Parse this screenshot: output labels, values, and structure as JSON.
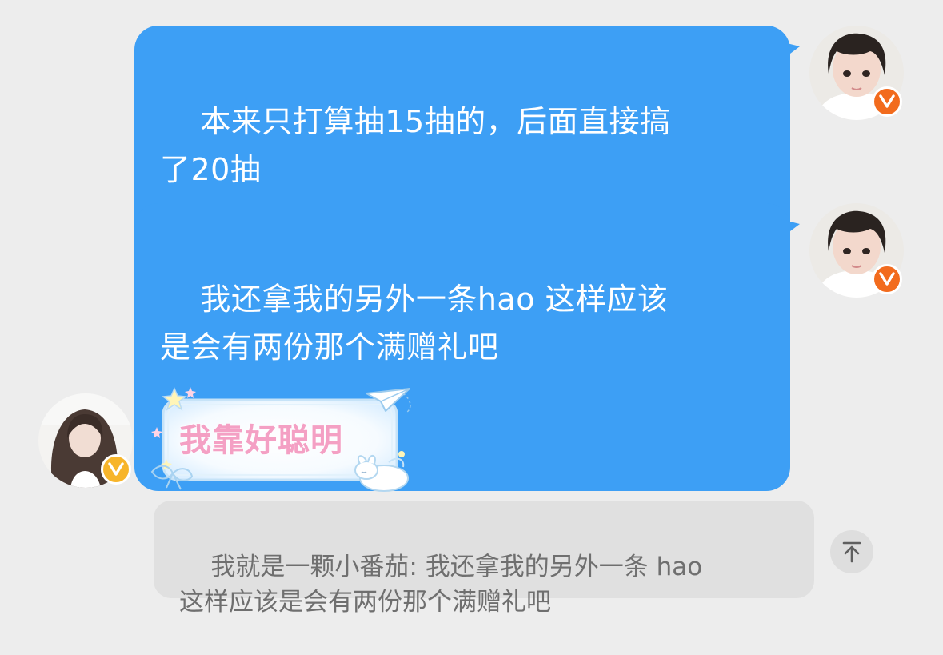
{
  "colors": {
    "background": "#ededed",
    "outgoing_bubble": "#3d9ff5",
    "quote_bubble": "#e0e0e0",
    "verified_badge_orange": "#f26b1d",
    "verified_badge_yellow": "#f7b52b",
    "sticker_text": "#f4a0c4"
  },
  "messages": [
    {
      "direction": "outgoing",
      "text": "本来只打算抽15抽的，后面直接搞\n了20抽",
      "avatar_icon": "user-avatar-icon",
      "badge": "V"
    },
    {
      "direction": "outgoing",
      "text": "我还拿我的另外一条hao 这样应该\n是会有两份那个满赠礼吧",
      "avatar_icon": "user-avatar-icon",
      "badge": "V"
    },
    {
      "direction": "incoming",
      "sticker_text": "我靠好聪明",
      "avatar_icon": "contact-avatar-icon",
      "badge": "V"
    }
  ],
  "quote": {
    "text": "我就是一颗小番茄: 我还拿我的另外一条 hao\n这样应该是会有两份那个满赠礼吧",
    "action_icon": "arrow-up-icon"
  }
}
